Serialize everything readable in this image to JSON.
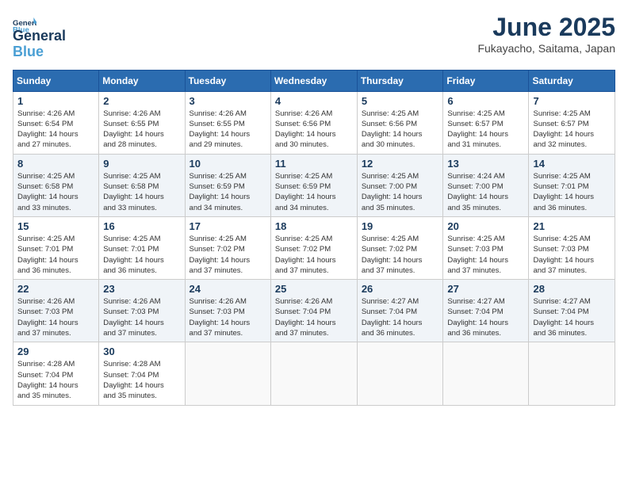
{
  "logo": {
    "general": "General",
    "blue": "Blue",
    "tagline": ""
  },
  "title": {
    "month": "June 2025",
    "location": "Fukayacho, Saitama, Japan"
  },
  "days_of_week": [
    "Sunday",
    "Monday",
    "Tuesday",
    "Wednesday",
    "Thursday",
    "Friday",
    "Saturday"
  ],
  "weeks": [
    [
      {
        "day": "1",
        "detail": "Sunrise: 4:26 AM\nSunset: 6:54 PM\nDaylight: 14 hours\nand 27 minutes."
      },
      {
        "day": "2",
        "detail": "Sunrise: 4:26 AM\nSunset: 6:55 PM\nDaylight: 14 hours\nand 28 minutes."
      },
      {
        "day": "3",
        "detail": "Sunrise: 4:26 AM\nSunset: 6:55 PM\nDaylight: 14 hours\nand 29 minutes."
      },
      {
        "day": "4",
        "detail": "Sunrise: 4:26 AM\nSunset: 6:56 PM\nDaylight: 14 hours\nand 30 minutes."
      },
      {
        "day": "5",
        "detail": "Sunrise: 4:25 AM\nSunset: 6:56 PM\nDaylight: 14 hours\nand 30 minutes."
      },
      {
        "day": "6",
        "detail": "Sunrise: 4:25 AM\nSunset: 6:57 PM\nDaylight: 14 hours\nand 31 minutes."
      },
      {
        "day": "7",
        "detail": "Sunrise: 4:25 AM\nSunset: 6:57 PM\nDaylight: 14 hours\nand 32 minutes."
      }
    ],
    [
      {
        "day": "8",
        "detail": "Sunrise: 4:25 AM\nSunset: 6:58 PM\nDaylight: 14 hours\nand 33 minutes."
      },
      {
        "day": "9",
        "detail": "Sunrise: 4:25 AM\nSunset: 6:58 PM\nDaylight: 14 hours\nand 33 minutes."
      },
      {
        "day": "10",
        "detail": "Sunrise: 4:25 AM\nSunset: 6:59 PM\nDaylight: 14 hours\nand 34 minutes."
      },
      {
        "day": "11",
        "detail": "Sunrise: 4:25 AM\nSunset: 6:59 PM\nDaylight: 14 hours\nand 34 minutes."
      },
      {
        "day": "12",
        "detail": "Sunrise: 4:25 AM\nSunset: 7:00 PM\nDaylight: 14 hours\nand 35 minutes."
      },
      {
        "day": "13",
        "detail": "Sunrise: 4:24 AM\nSunset: 7:00 PM\nDaylight: 14 hours\nand 35 minutes."
      },
      {
        "day": "14",
        "detail": "Sunrise: 4:25 AM\nSunset: 7:01 PM\nDaylight: 14 hours\nand 36 minutes."
      }
    ],
    [
      {
        "day": "15",
        "detail": "Sunrise: 4:25 AM\nSunset: 7:01 PM\nDaylight: 14 hours\nand 36 minutes."
      },
      {
        "day": "16",
        "detail": "Sunrise: 4:25 AM\nSunset: 7:01 PM\nDaylight: 14 hours\nand 36 minutes."
      },
      {
        "day": "17",
        "detail": "Sunrise: 4:25 AM\nSunset: 7:02 PM\nDaylight: 14 hours\nand 37 minutes."
      },
      {
        "day": "18",
        "detail": "Sunrise: 4:25 AM\nSunset: 7:02 PM\nDaylight: 14 hours\nand 37 minutes."
      },
      {
        "day": "19",
        "detail": "Sunrise: 4:25 AM\nSunset: 7:02 PM\nDaylight: 14 hours\nand 37 minutes."
      },
      {
        "day": "20",
        "detail": "Sunrise: 4:25 AM\nSunset: 7:03 PM\nDaylight: 14 hours\nand 37 minutes."
      },
      {
        "day": "21",
        "detail": "Sunrise: 4:25 AM\nSunset: 7:03 PM\nDaylight: 14 hours\nand 37 minutes."
      }
    ],
    [
      {
        "day": "22",
        "detail": "Sunrise: 4:26 AM\nSunset: 7:03 PM\nDaylight: 14 hours\nand 37 minutes."
      },
      {
        "day": "23",
        "detail": "Sunrise: 4:26 AM\nSunset: 7:03 PM\nDaylight: 14 hours\nand 37 minutes."
      },
      {
        "day": "24",
        "detail": "Sunrise: 4:26 AM\nSunset: 7:03 PM\nDaylight: 14 hours\nand 37 minutes."
      },
      {
        "day": "25",
        "detail": "Sunrise: 4:26 AM\nSunset: 7:04 PM\nDaylight: 14 hours\nand 37 minutes."
      },
      {
        "day": "26",
        "detail": "Sunrise: 4:27 AM\nSunset: 7:04 PM\nDaylight: 14 hours\nand 36 minutes."
      },
      {
        "day": "27",
        "detail": "Sunrise: 4:27 AM\nSunset: 7:04 PM\nDaylight: 14 hours\nand 36 minutes."
      },
      {
        "day": "28",
        "detail": "Sunrise: 4:27 AM\nSunset: 7:04 PM\nDaylight: 14 hours\nand 36 minutes."
      }
    ],
    [
      {
        "day": "29",
        "detail": "Sunrise: 4:28 AM\nSunset: 7:04 PM\nDaylight: 14 hours\nand 35 minutes."
      },
      {
        "day": "30",
        "detail": "Sunrise: 4:28 AM\nSunset: 7:04 PM\nDaylight: 14 hours\nand 35 minutes."
      },
      {
        "day": "",
        "detail": ""
      },
      {
        "day": "",
        "detail": ""
      },
      {
        "day": "",
        "detail": ""
      },
      {
        "day": "",
        "detail": ""
      },
      {
        "day": "",
        "detail": ""
      }
    ]
  ]
}
